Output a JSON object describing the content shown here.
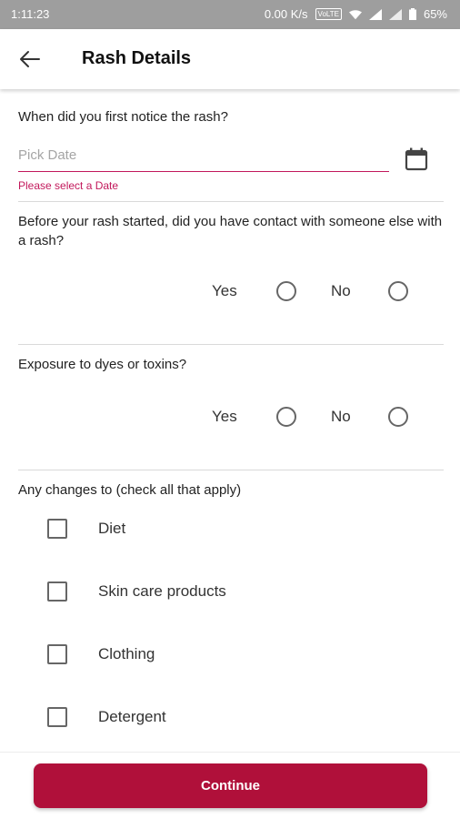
{
  "status_bar": {
    "time": "1:11:23",
    "network_speed": "0.00 K/s",
    "volte_label": "VoLTE",
    "battery": "65%"
  },
  "header": {
    "title": "Rash Details",
    "back_icon": "arrow-back-icon"
  },
  "form": {
    "date_question": "When did you first notice the rash?",
    "date_placeholder": "Pick Date",
    "date_value": "",
    "date_error": "Please select a Date",
    "calendar_icon": "calendar-icon",
    "contact_question": "Before your rash started, did you have contact with someone else with a rash?",
    "contact_options": {
      "yes": "Yes",
      "no": "No"
    },
    "exposure_question": "Exposure to dyes or toxins?",
    "exposure_options": {
      "yes": "Yes",
      "no": "No"
    },
    "changes_question": "Any changes to (check all that apply)",
    "changes_items": [
      {
        "label": "Diet",
        "checked": false
      },
      {
        "label": "Skin care products",
        "checked": false
      },
      {
        "label": "Clothing",
        "checked": false
      },
      {
        "label": "Detergent",
        "checked": false
      }
    ]
  },
  "footer": {
    "continue_label": "Continue"
  },
  "colors": {
    "accent": "#b0103a",
    "error": "#c2185b",
    "status_bar": "#9e9e9e"
  }
}
